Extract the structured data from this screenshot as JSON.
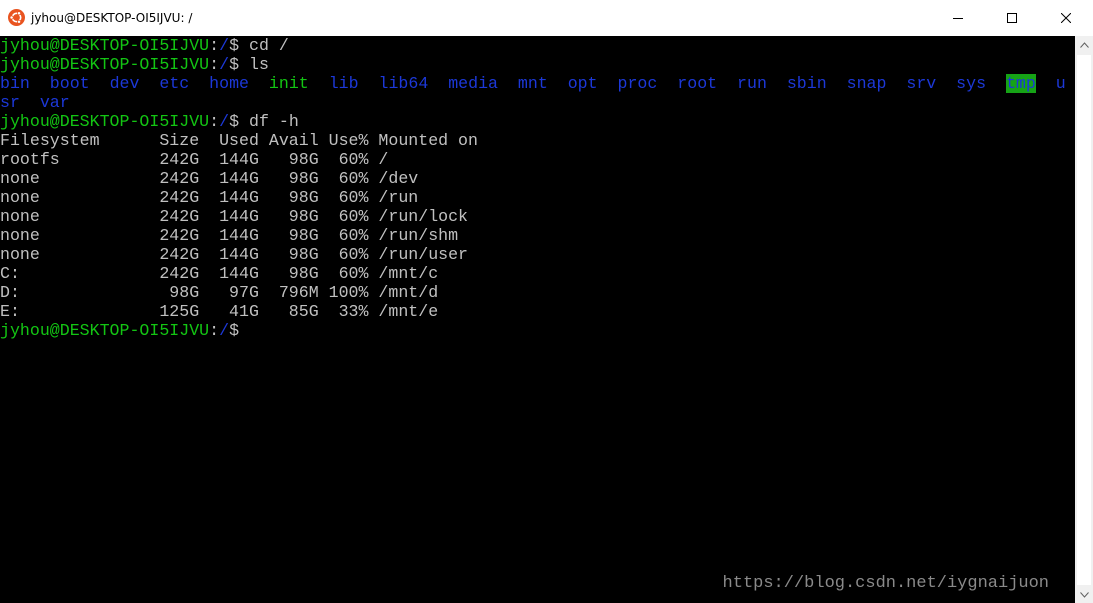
{
  "window": {
    "title": "jyhou@DESKTOP-OI5IJVU: /",
    "icon": "ubuntu-icon"
  },
  "terminal": {
    "prompt": {
      "userhost": "jyhou@DESKTOP-OI5IJVU",
      "colon": ":",
      "path": "/",
      "dollar": "$"
    },
    "commands": [
      "cd /",
      "ls",
      "df -h"
    ],
    "ls_output": [
      "bin",
      "boot",
      "dev",
      "etc",
      "home",
      "init",
      "lib",
      "lib64",
      "media",
      "mnt",
      "opt",
      "proc",
      "root",
      "run",
      "sbin",
      "snap",
      "srv",
      "sys",
      "tmp",
      "u",
      "sr",
      "var"
    ],
    "df_header": "Filesystem      Size  Used Avail Use% Mounted on",
    "df_rows": [
      "rootfs          242G  144G   98G  60% /",
      "none            242G  144G   98G  60% /dev",
      "none            242G  144G   98G  60% /run",
      "none            242G  144G   98G  60% /run/lock",
      "none            242G  144G   98G  60% /run/shm",
      "none            242G  144G   98G  60% /run/user",
      "C:              242G  144G   98G  60% /mnt/c",
      "D:               98G   97G  796M 100% /mnt/d",
      "E:              125G   41G   85G  33% /mnt/e"
    ]
  },
  "watermark": "https://blog.csdn.net/iygnaijuon",
  "colors": {
    "prompt_green": "#13c513",
    "dir_blue": "#1c38d8",
    "tmp_highlight_bg": "#16a316",
    "text": "#c0c0c0",
    "background": "#000000"
  }
}
